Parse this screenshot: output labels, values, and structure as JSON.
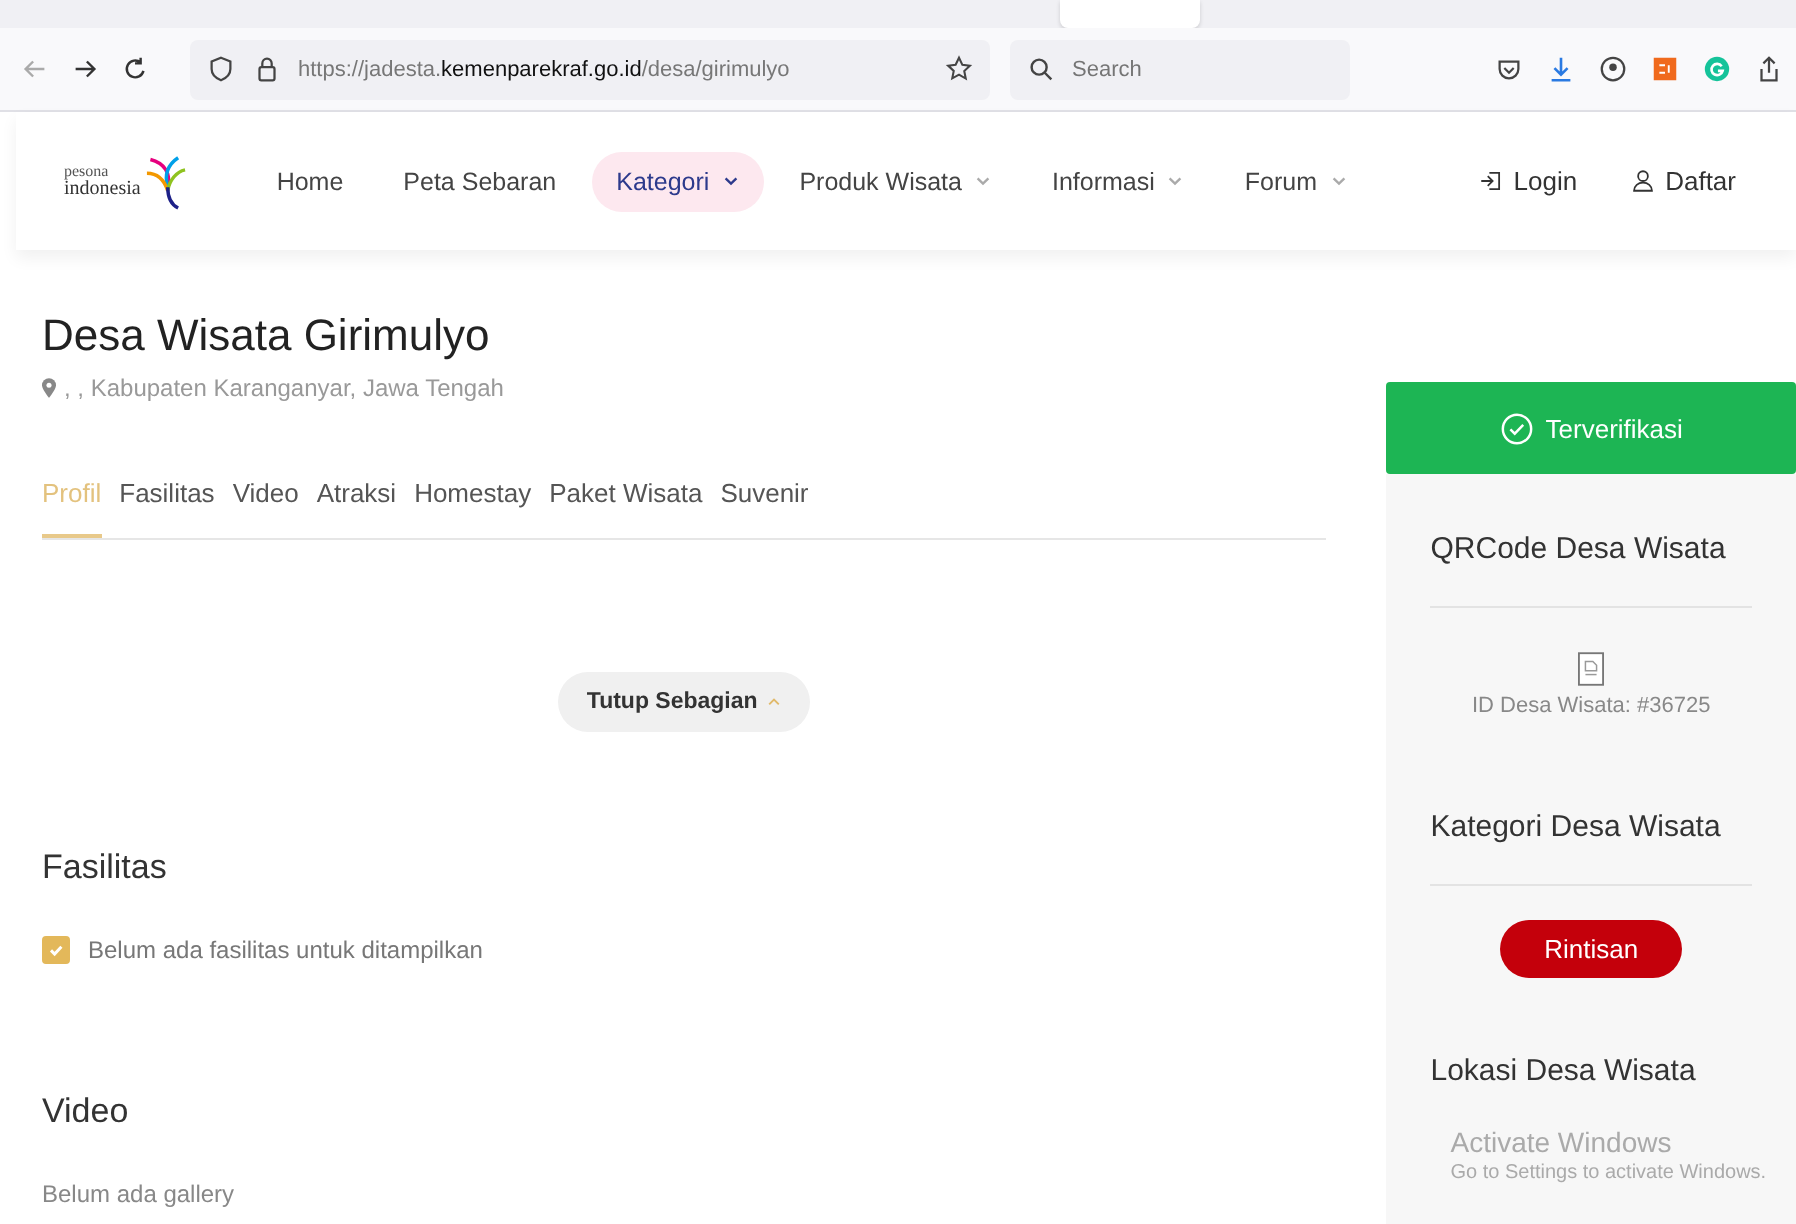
{
  "browser": {
    "url": "https://jadesta.**kemenparekraf.go.id**/desa/girimulyo",
    "search_placeholder": "Search"
  },
  "nav": {
    "logo_top": "pesona",
    "logo_bottom": "indonesia",
    "items": [
      {
        "label": "Home",
        "selected": false,
        "dropdown": false
      },
      {
        "label": "Peta Sebaran",
        "selected": false,
        "dropdown": false
      },
      {
        "label": "Kategori",
        "selected": true,
        "dropdown": true
      },
      {
        "label": "Produk Wisata",
        "selected": false,
        "dropdown": true
      },
      {
        "label": "Informasi",
        "selected": false,
        "dropdown": true
      },
      {
        "label": "Forum",
        "selected": false,
        "dropdown": true
      }
    ],
    "login": "Login",
    "register": "Daftar"
  },
  "title": "Desa Wisata Girimulyo",
  "location": ", , Kabupaten Karanganyar, Jawa Tengah",
  "tabs": [
    {
      "label": "Profil",
      "selected": true
    },
    {
      "label": "Fasilitas",
      "selected": false
    },
    {
      "label": "Video",
      "selected": false
    },
    {
      "label": "Atraksi",
      "selected": false
    },
    {
      "label": "Homestay",
      "selected": false
    },
    {
      "label": "Paket Wisata",
      "selected": false
    },
    {
      "label": "Suvenir",
      "selected": false
    }
  ],
  "collapse_button": "Tutup Sebagian",
  "fasilitas": {
    "heading": "Fasilitas",
    "items": [
      {
        "label": "Belum ada fasilitas untuk ditampilkan",
        "checked": true
      }
    ]
  },
  "video": {
    "heading": "Video",
    "empty": "Belum ada gallery"
  },
  "sidebar": {
    "verified": "Terverifikasi",
    "qr_heading": "QRCode Desa Wisata",
    "id_text": "ID Desa Wisata: #36725",
    "category_heading": "Kategori Desa Wisata",
    "category": "Rintisan",
    "location_heading": "Lokasi Desa Wisata"
  },
  "os_notice": {
    "title": "Activate Windows",
    "text": "Go to Settings to activate Windows."
  }
}
